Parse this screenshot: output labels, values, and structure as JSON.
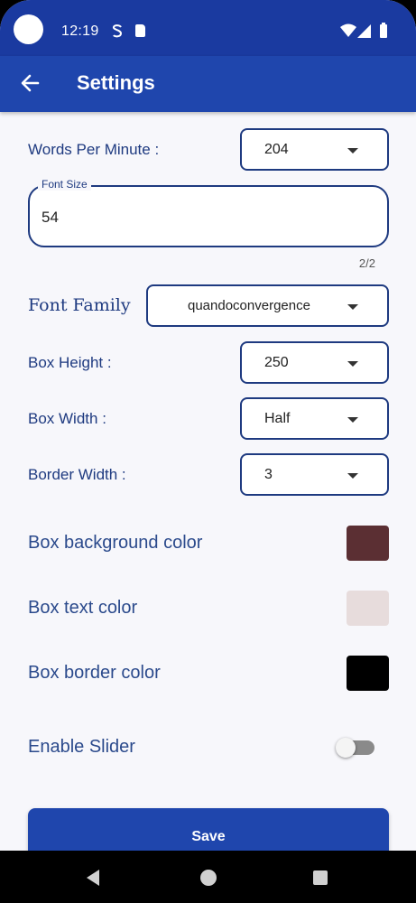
{
  "status_bar": {
    "time": "12:19",
    "icons": [
      "s-icon",
      "sd-card-icon",
      "wifi-icon",
      "signal-icon",
      "battery-icon"
    ]
  },
  "app_bar": {
    "title": "Settings",
    "back_icon": "arrow-left-icon"
  },
  "settings": {
    "words_per_minute": {
      "label": "Words Per Minute :",
      "value": "204"
    },
    "font_size": {
      "label": "Font Size",
      "value": "54",
      "counter": "2/2"
    },
    "font_family": {
      "label": "Font Family",
      "value": "quandoconvergence"
    },
    "box_height": {
      "label": "Box Height :",
      "value": "250"
    },
    "box_width": {
      "label": "Box Width :",
      "value": "Half"
    },
    "border_width": {
      "label": "Border Width :",
      "value": "3"
    },
    "box_background_color": {
      "label": "Box background color",
      "color": "#5b2f33"
    },
    "box_text_color": {
      "label": "Box text color",
      "color": "#e7dcdc"
    },
    "box_border_color": {
      "label": "Box border color",
      "color": "#000000"
    },
    "enable_slider": {
      "label": "Enable Slider",
      "enabled": false
    }
  },
  "save_label": "Save",
  "colors": {
    "primary": "#1f46ad",
    "status_bar": "#1a3aa0",
    "label": "#1e3a80",
    "background": "#f7f7fb"
  }
}
